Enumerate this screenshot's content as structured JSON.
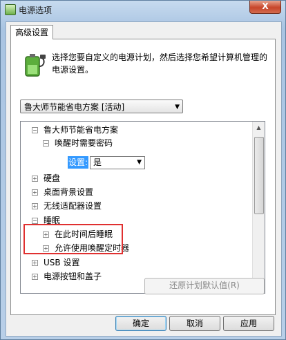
{
  "window": {
    "title": "电源选项",
    "close_label": "X"
  },
  "tab": {
    "label": "高级设置"
  },
  "description": "选择您要自定义的电源计划，然后选择您希望计算机管理的电源设置。",
  "plan_select": {
    "value": "鲁大师节能省电方案 [活动]"
  },
  "tree": {
    "items": [
      {
        "label": "鲁大师节能省电方案",
        "expander": "−"
      },
      {
        "label": "唤醒时需要密码",
        "expander": "−"
      },
      {
        "label": "硬盘",
        "expander": "+"
      },
      {
        "label": "桌面背景设置",
        "expander": "+"
      },
      {
        "label": "无线适配器设置",
        "expander": "+"
      },
      {
        "label": "睡眠",
        "expander": "−"
      },
      {
        "label": "在此时间后睡眠",
        "expander": "+"
      },
      {
        "label": "允许使用唤醒定时器",
        "expander": "+"
      },
      {
        "label": "USB 设置",
        "expander": "+"
      },
      {
        "label": "电源按钮和盖子",
        "expander": "+"
      }
    ],
    "setting": {
      "label": "设置:",
      "value": "是"
    }
  },
  "buttons": {
    "restore": "还原计划默认值(R)",
    "ok": "确定",
    "cancel": "取消",
    "apply": "应用"
  },
  "colors": {
    "highlight_box": "#e03030",
    "selection": "#3399ff"
  }
}
